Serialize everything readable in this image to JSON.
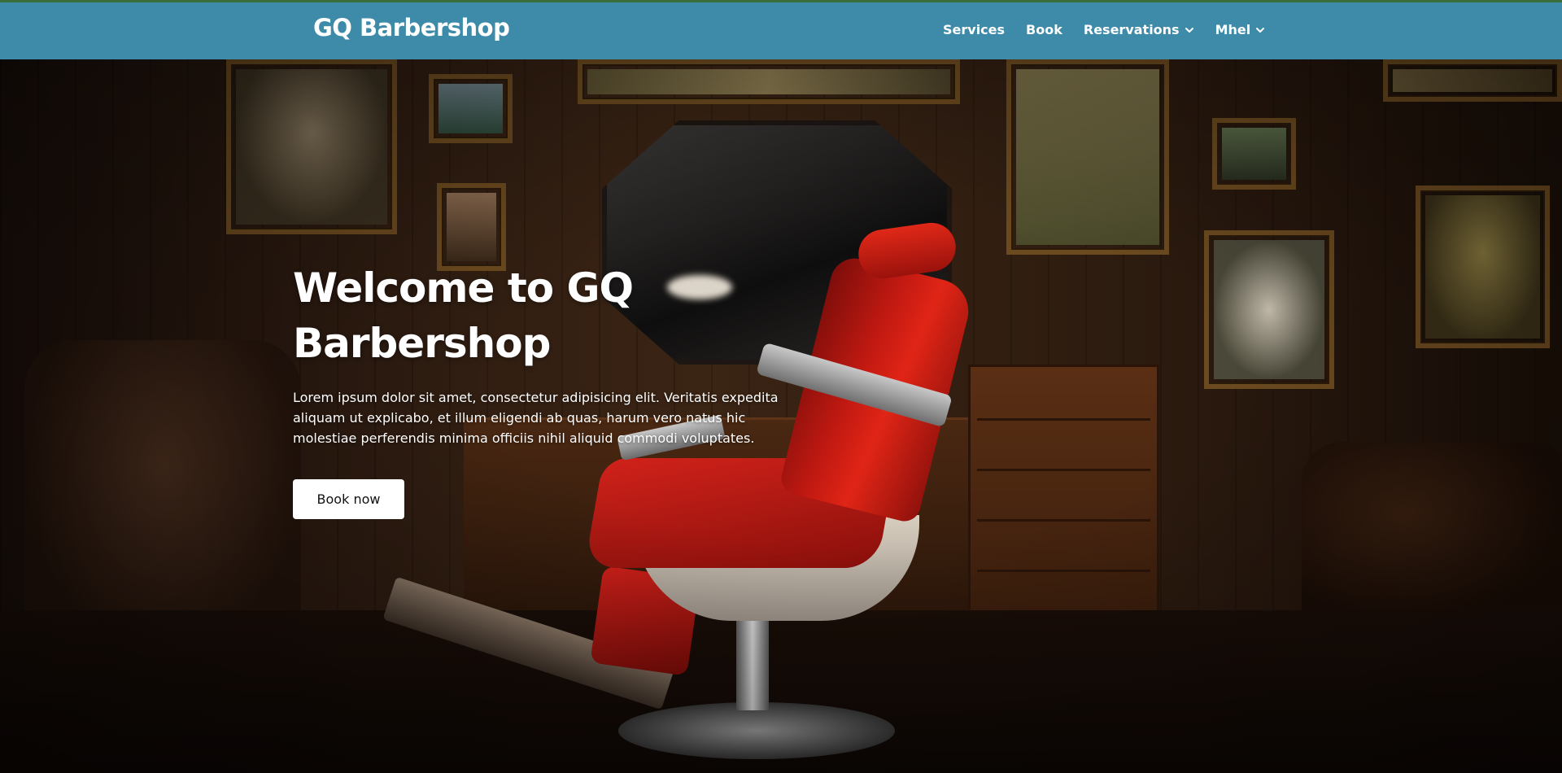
{
  "navbar": {
    "brand": "GQ Barbershop",
    "items": [
      {
        "label": "Services",
        "dropdown": false
      },
      {
        "label": "Book",
        "dropdown": false
      },
      {
        "label": "Reservations",
        "dropdown": true
      },
      {
        "label": "Mhel",
        "dropdown": true
      }
    ]
  },
  "hero": {
    "title": "Welcome to GQ Barbershop",
    "text": "Lorem ipsum dolor sit amet, consectetur adipisicing elit. Veritatis expedita aliquam ut explicabo, et illum eligendi ab quas, harum vero natus hic molestiae perferendis minima officiis nihil aliquid commodi voluptates.",
    "button_label": "Book now"
  },
  "colors": {
    "navbar": "#3d8ba8",
    "accent_line": "#3b6e3a",
    "button_bg": "#ffffff"
  },
  "icons": {
    "dropdown": "chevron-down-icon"
  }
}
